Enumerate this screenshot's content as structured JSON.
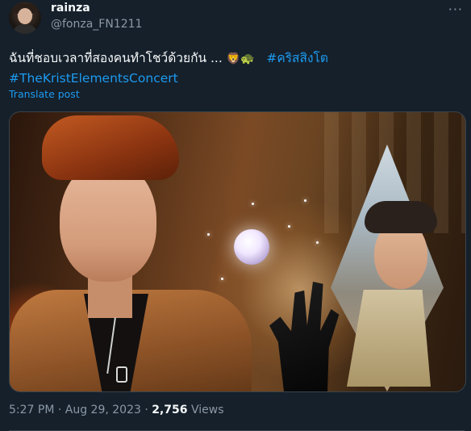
{
  "tweet": {
    "display_name": "rainza",
    "handle": "@fonza_FN1211",
    "more_icon": "more-horizontal-icon",
    "text": "ฉันที่ชอบเวลาที่สองคนทำโชว์ด้วยกัน ... ",
    "emojis": [
      "🦁",
      "🐢"
    ],
    "hashtag_1": "#คริสสิงโต",
    "hashtag_2": "#TheKristElementsConcert",
    "translate_label": "Translate post",
    "timestamp": "5:27 PM · Aug 29, 2023 · ",
    "views_count": "2,756",
    "views_label": " Views"
  }
}
